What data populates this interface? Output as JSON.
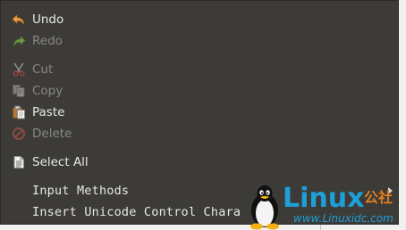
{
  "context_menu": {
    "items": [
      {
        "label": "Undo",
        "icon": "undo-icon",
        "enabled": true
      },
      {
        "label": "Redo",
        "icon": "redo-icon",
        "enabled": false
      },
      {
        "label": "Cut",
        "icon": "cut-icon",
        "enabled": false
      },
      {
        "label": "Copy",
        "icon": "copy-icon",
        "enabled": false
      },
      {
        "label": "Paste",
        "icon": "paste-icon",
        "enabled": true
      },
      {
        "label": "Delete",
        "icon": "delete-icon",
        "enabled": false
      },
      {
        "label": "Select All",
        "icon": "select-all-icon",
        "enabled": true
      },
      {
        "label": "Input Methods",
        "icon": "chevron-right-icon",
        "enabled": true
      },
      {
        "label": "Insert Unicode Control Chara",
        "enabled": true
      }
    ]
  },
  "watermark": {
    "brand": "Linux",
    "brand_suffix": "公社",
    "url": "www.Linuxidc.com",
    "colors": {
      "blue": "#1f9fd8",
      "orange": "#e07d20"
    }
  },
  "colors": {
    "menu_bg": "#3c3b37",
    "text_enabled": "#e9e8e5",
    "text_disabled": "#8a8883",
    "desktop_bg": "#f2f1f0"
  }
}
